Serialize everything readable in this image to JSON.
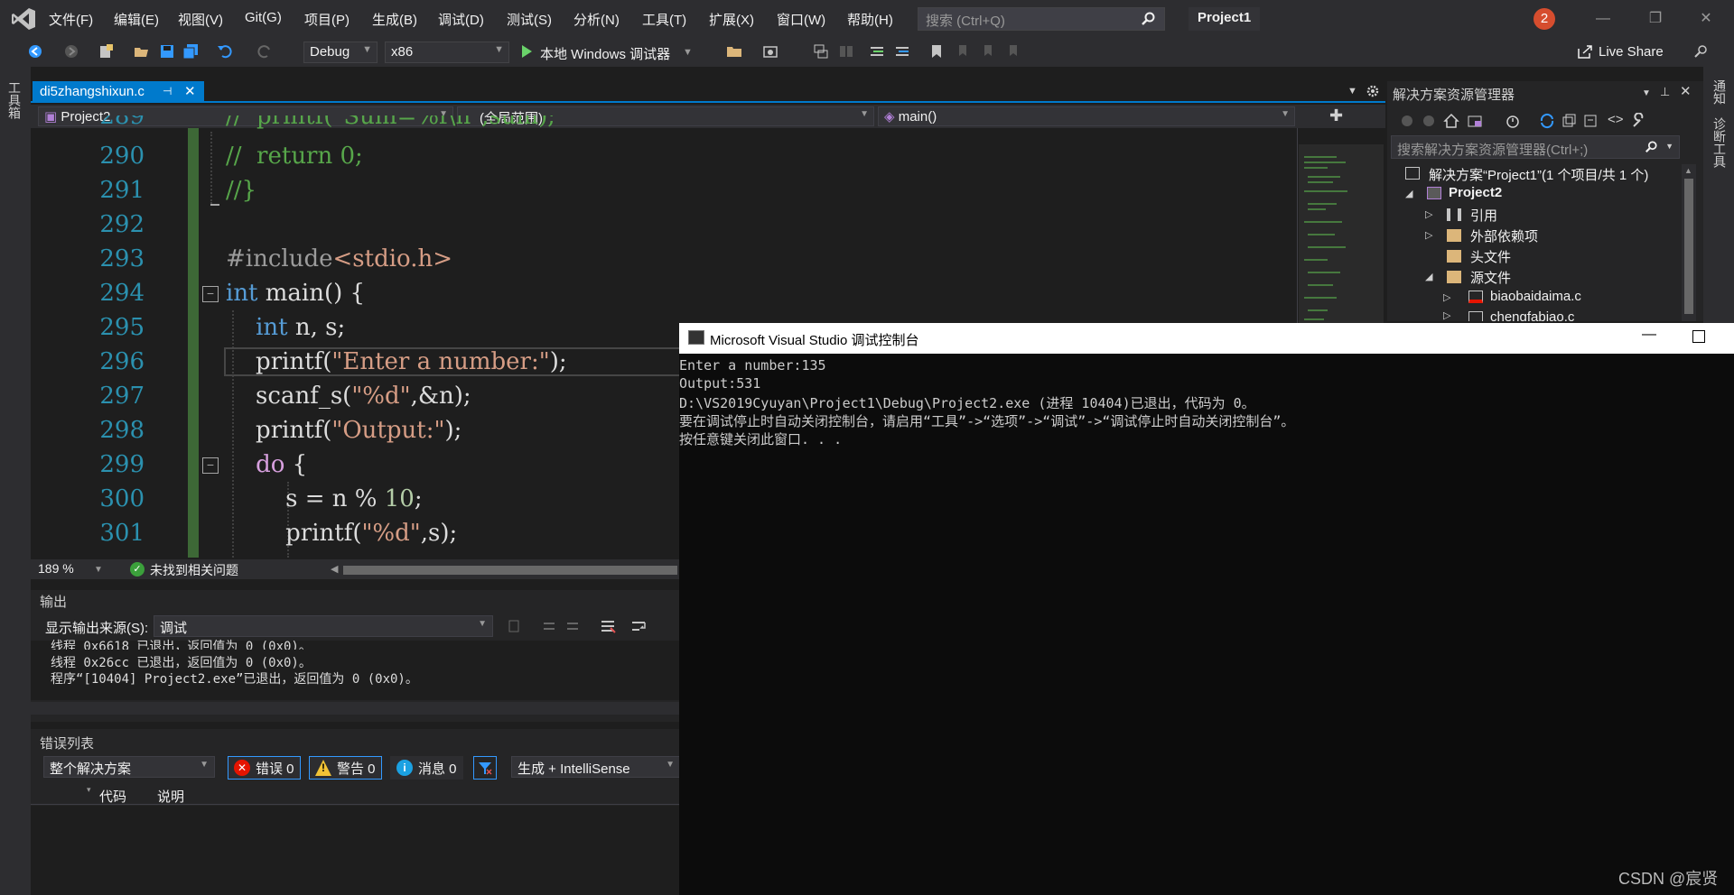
{
  "menu": [
    "文件(F)",
    "编辑(E)",
    "视图(V)",
    "Git(G)",
    "项目(P)",
    "生成(B)",
    "调试(D)",
    "测试(S)",
    "分析(N)",
    "工具(T)",
    "扩展(X)",
    "窗口(W)",
    "帮助(H)"
  ],
  "search": {
    "placeholder": "搜索 (Ctrl+Q)"
  },
  "project_title": "Project1",
  "notification_count": "2",
  "toolbar": {
    "config": "Debug",
    "platform": "x86",
    "run_label": "本地 Windows 调试器",
    "live_share": "Live Share"
  },
  "left_tab": "工具箱",
  "doc_tab": {
    "name": "di5zhangshixun.c"
  },
  "navbar": {
    "project": "Project2",
    "scope": "(全局范围)",
    "member": "main()"
  },
  "code_lines": [
    {
      "n": "290",
      "text": "//  return 0;"
    },
    {
      "n": "291",
      "text": "//}"
    },
    {
      "n": "292",
      "text": ""
    },
    {
      "n": "293",
      "text": "#include<stdio.h>"
    },
    {
      "n": "294",
      "text": "int main() {"
    },
    {
      "n": "295",
      "text": "    int n, s;"
    },
    {
      "n": "296",
      "text": "    printf(\"Enter a number:\");"
    },
    {
      "n": "297",
      "text": "    scanf_s(\"%d\",&n);"
    },
    {
      "n": "298",
      "text": "    printf(\"Output:\");"
    },
    {
      "n": "299",
      "text": "    do {"
    },
    {
      "n": "300",
      "text": "        s = n % 10;"
    },
    {
      "n": "301",
      "text": "        printf(\"%d\",s);"
    }
  ],
  "editor_status": {
    "zoom": "189 %",
    "issues": "未找到相关问题"
  },
  "output": {
    "title": "输出",
    "source_label": "显示输出来源(S):",
    "source": "调试",
    "lines": [
      "线程 0x6618 已退出，返回值为 0 (0x0)。",
      "线程 0x26cc 已退出，返回值为 0 (0x0)。",
      "程序“[10404] Project2.exe”已退出，返回值为 0 (0x0)。"
    ]
  },
  "errors": {
    "title": "错误列表",
    "scope": "整个解决方案",
    "errors_btn": "错误 0",
    "warnings_btn": "警告 0",
    "messages_btn": "消息 0",
    "build_filter": "生成 + IntelliSense",
    "col_code": "代码",
    "col_desc": "说明"
  },
  "solution": {
    "title": "解决方案资源管理器",
    "search_placeholder": "搜索解决方案资源管理器(Ctrl+;)",
    "items": [
      {
        "label": "解决方案“Project1”(1 个项目/共 1 个)"
      },
      {
        "label": "Project2"
      },
      {
        "label": "引用"
      },
      {
        "label": "外部依赖项"
      },
      {
        "label": "头文件"
      },
      {
        "label": "源文件"
      },
      {
        "label": "biaobaidaima.c"
      },
      {
        "label": "chengfabiao.c"
      }
    ]
  },
  "right_tabs": [
    "通知",
    "诊断工具"
  ],
  "console": {
    "title": "Microsoft Visual Studio 调试控制台",
    "lines": [
      "Enter a number:135",
      "Output:531",
      "D:\\VS2019Cyuyan\\Project1\\Debug\\Project2.exe (进程 10404)已退出，代码为 0。",
      "要在调试停止时自动关闭控制台，请启用“工具”->“选项”->“调试”->“调试停止时自动关闭控制台”。",
      "按任意键关闭此窗口. . ."
    ]
  },
  "watermark": "CSDN @宸贤",
  "colors": {
    "accent": "#007acc",
    "background": "#1e1e1e",
    "chrome": "#2d2d30"
  }
}
